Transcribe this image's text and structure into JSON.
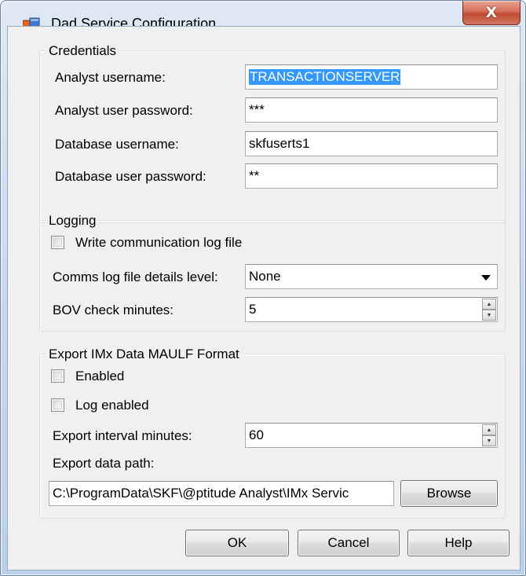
{
  "window": {
    "title": "Dad Service Configuration",
    "close_glyph": "X"
  },
  "credentials": {
    "legend": "Credentials",
    "analyst_username_label": "Analyst username:",
    "analyst_username_value": "TRANSACTIONSERVER",
    "analyst_password_label": "Analyst user password:",
    "analyst_password_value": "***",
    "db_username_label": "Database username:",
    "db_username_value": "skfuserts1",
    "db_password_label": "Database user password:",
    "db_password_value": "**"
  },
  "logging": {
    "legend": "Logging",
    "write_log_label": "Write communication log file",
    "write_log_checked": false,
    "details_level_label": "Comms log file details level:",
    "details_level_value": "None",
    "bov_label": "BOV check minutes:",
    "bov_value": "5"
  },
  "export": {
    "legend": "Export IMx Data MAULF Format",
    "enabled_label": "Enabled",
    "enabled_checked": false,
    "log_enabled_label": "Log enabled",
    "log_enabled_checked": false,
    "interval_label": "Export interval minutes:",
    "interval_value": "60",
    "path_label": "Export data path:",
    "path_value": "C:\\ProgramData\\SKF\\@ptitude Analyst\\IMx Servic",
    "browse_label": "Browse"
  },
  "buttons": {
    "ok": "OK",
    "cancel": "Cancel",
    "help": "Help"
  },
  "colors": {
    "selection": "#3399ff",
    "close_button": "#c24a33"
  },
  "icons": {
    "app": "app-window-icon",
    "close": "close-icon",
    "dropdown": "chevron-down-icon",
    "spin_up": "spin-up-icon",
    "spin_down": "spin-down-icon"
  }
}
